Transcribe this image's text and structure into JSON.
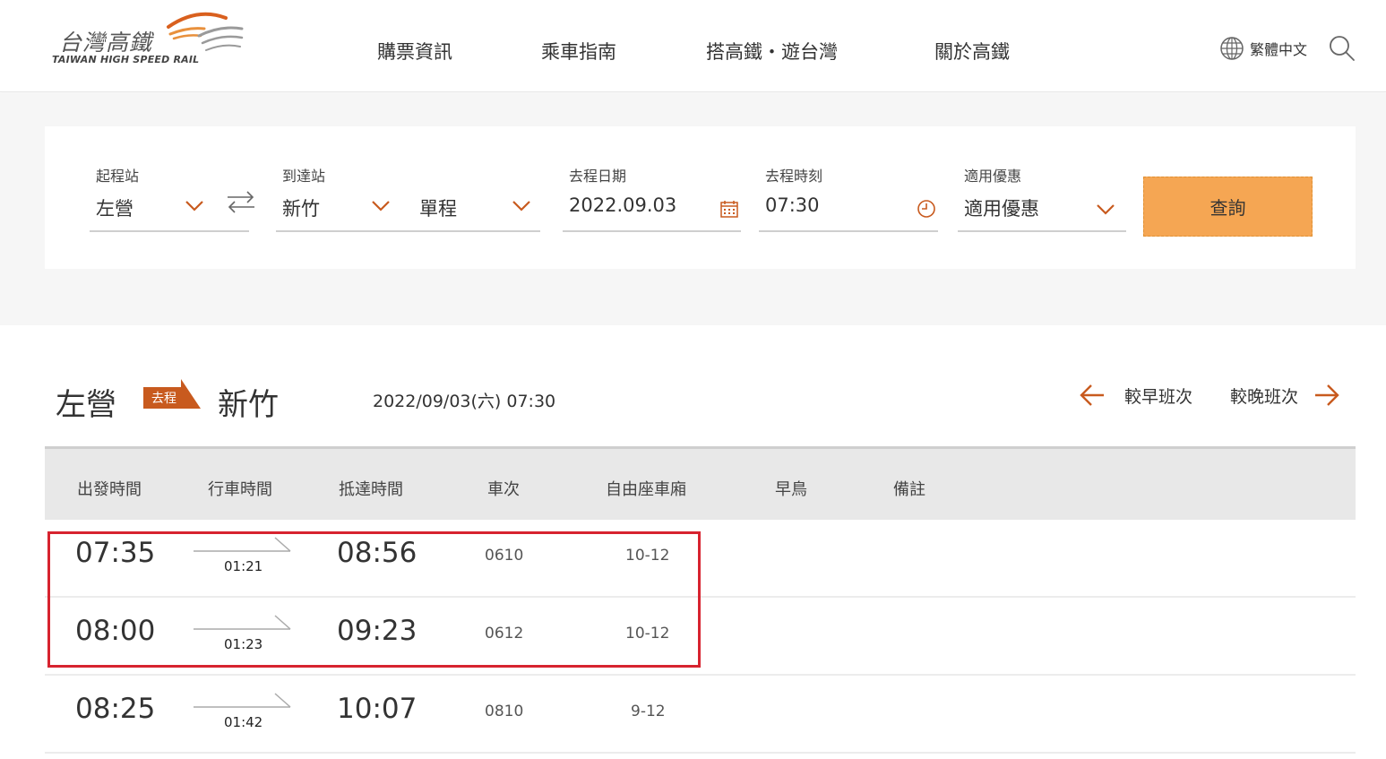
{
  "header": {
    "logo_cn": "台灣高鐵",
    "logo_en": "TAIWAN HIGH SPEED RAIL",
    "nav": [
      "購票資訊",
      "乘車指南",
      "搭高鐵・遊台灣",
      "關於高鐵"
    ],
    "lang": "繁體中文"
  },
  "search": {
    "from_label": "起程站",
    "from_value": "左營",
    "to_label": "到達站",
    "to_value": "新竹",
    "trip_type": "單程",
    "date_label": "去程日期",
    "date_value": "2022.09.03",
    "time_label": "去程時刻",
    "time_value": "07:30",
    "discount_label": "適用優惠",
    "discount_value": "適用優惠",
    "query_label": "查詢"
  },
  "result": {
    "from": "左營",
    "badge": "去程",
    "to": "新竹",
    "datetime": "2022/09/03(六) 07:30",
    "earlier": "較早班次",
    "later": "較晚班次"
  },
  "table": {
    "headers": [
      "出發時間",
      "行車時間",
      "抵達時間",
      "車次",
      "自由座車廂",
      "早鳥",
      "備註"
    ],
    "rows": [
      {
        "dep": "07:35",
        "dur": "01:21",
        "arr": "08:56",
        "train": "0610",
        "cars": "10-12"
      },
      {
        "dep": "08:00",
        "dur": "01:23",
        "arr": "09:23",
        "train": "0612",
        "cars": "10-12"
      },
      {
        "dep": "08:25",
        "dur": "01:42",
        "arr": "10:07",
        "train": "0810",
        "cars": "9-12"
      }
    ]
  },
  "colors": {
    "accent": "#c85a1e",
    "button": "#f5a653",
    "highlight": "#d7232f"
  }
}
